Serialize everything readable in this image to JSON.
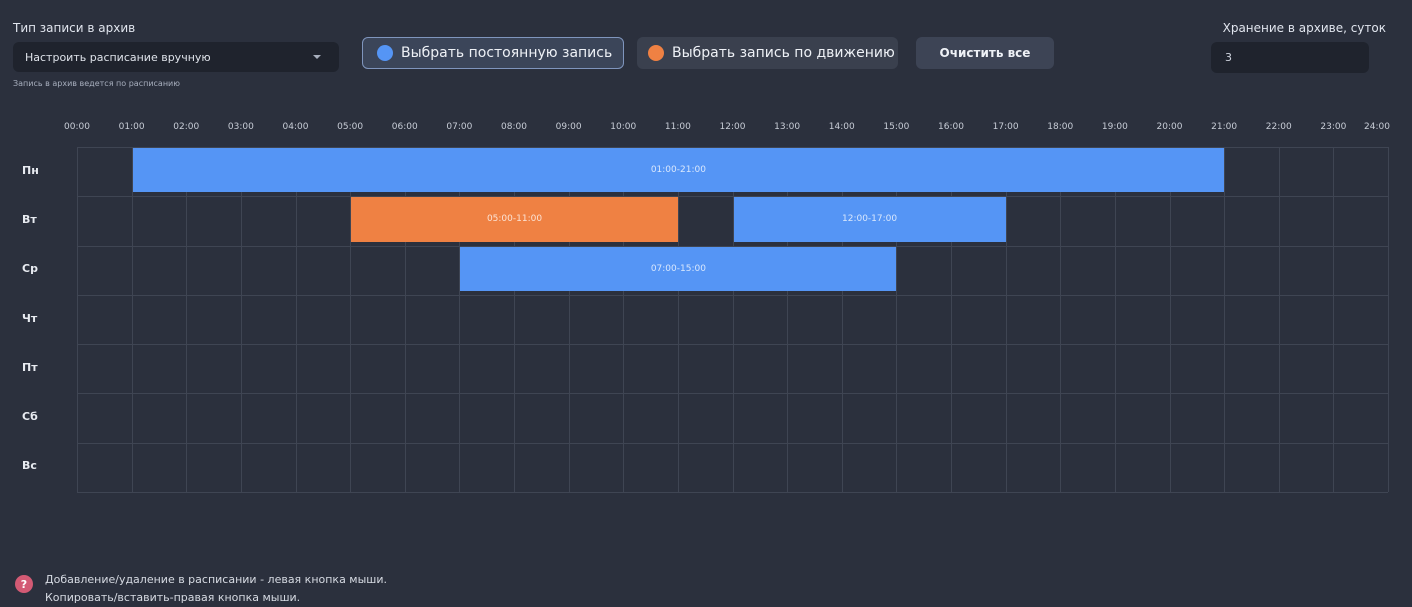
{
  "archive_type": {
    "label": "Тип записи в архив",
    "selected": "Настроить расписание вручную",
    "hint": "Запись в архив ведется по расписанию"
  },
  "buttons": {
    "permanent": "Выбрать постоянную запись",
    "motion": "Выбрать запись по движению",
    "clear": "Очистить все"
  },
  "storage": {
    "label": "Хранение в архиве, суток",
    "value": "3"
  },
  "colors": {
    "permanent": "#5595f5",
    "motion": "#ef8143"
  },
  "schedule": {
    "hours": [
      "00:00",
      "01:00",
      "02:00",
      "03:00",
      "04:00",
      "05:00",
      "06:00",
      "07:00",
      "08:00",
      "09:00",
      "10:00",
      "11:00",
      "12:00",
      "13:00",
      "14:00",
      "15:00",
      "16:00",
      "17:00",
      "18:00",
      "19:00",
      "20:00",
      "21:00",
      "22:00",
      "23:00",
      "24:00"
    ],
    "days": [
      "Пн",
      "Вт",
      "Ср",
      "Чт",
      "Пт",
      "Сб",
      "Вс"
    ],
    "blocks": [
      {
        "day": 0,
        "start": 1,
        "end": 21,
        "type": "permanent",
        "label": "01:00-21:00"
      },
      {
        "day": 1,
        "start": 5,
        "end": 11,
        "type": "motion",
        "label": "05:00-11:00"
      },
      {
        "day": 1,
        "start": 12,
        "end": 17,
        "type": "permanent",
        "label": "12:00-17:00"
      },
      {
        "day": 2,
        "start": 7,
        "end": 15,
        "type": "permanent",
        "label": "07:00-15:00"
      }
    ]
  },
  "help": {
    "icon": "question-icon",
    "line1": "Добавление/удаление в расписании - левая кнопка мыши.",
    "line2": "Копировать/вставить-правая кнопка мыши."
  }
}
